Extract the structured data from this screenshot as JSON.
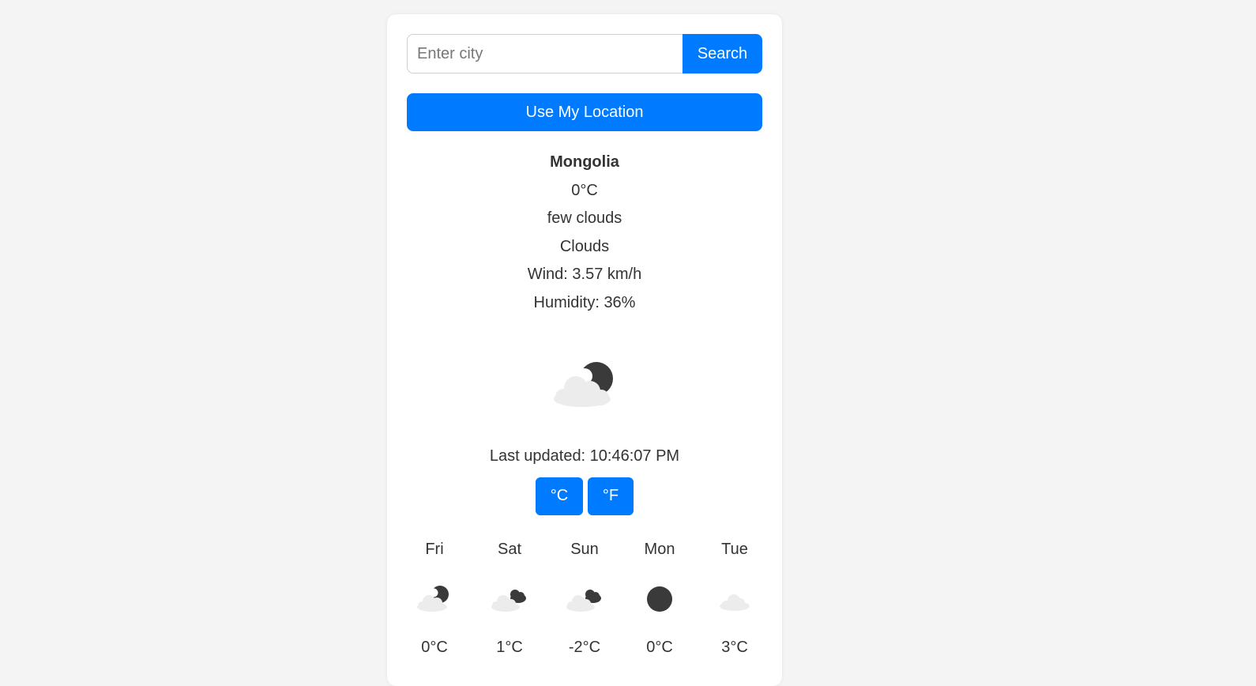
{
  "search": {
    "placeholder": "Enter city",
    "value": "",
    "button_label": "Search"
  },
  "location_button_label": "Use My Location",
  "current": {
    "city": "Mongolia",
    "temperature": "0°C",
    "description": "few clouds",
    "condition": "Clouds",
    "wind": "Wind: 3.57 km/h",
    "humidity": "Humidity: 36%",
    "icon": "few-clouds-night-icon"
  },
  "last_updated": "Last updated: 10:46:07 PM",
  "units": {
    "celsius_label": "°C",
    "fahrenheit_label": "°F"
  },
  "forecast": [
    {
      "day": "Fri",
      "temp": "0°C",
      "icon": "few-clouds-night-icon"
    },
    {
      "day": "Sat",
      "temp": "1°C",
      "icon": "broken-clouds-night-icon"
    },
    {
      "day": "Sun",
      "temp": "-2°C",
      "icon": "broken-clouds-night-icon"
    },
    {
      "day": "Mon",
      "temp": "0°C",
      "icon": "clear-night-icon"
    },
    {
      "day": "Tue",
      "temp": "3°C",
      "icon": "cloud-icon"
    }
  ],
  "colors": {
    "accent": "#007bff",
    "background": "#f4f4f4",
    "card": "#ffffff",
    "text": "#333333",
    "moon": "#3a3a3a",
    "cloud": "#ececec"
  }
}
